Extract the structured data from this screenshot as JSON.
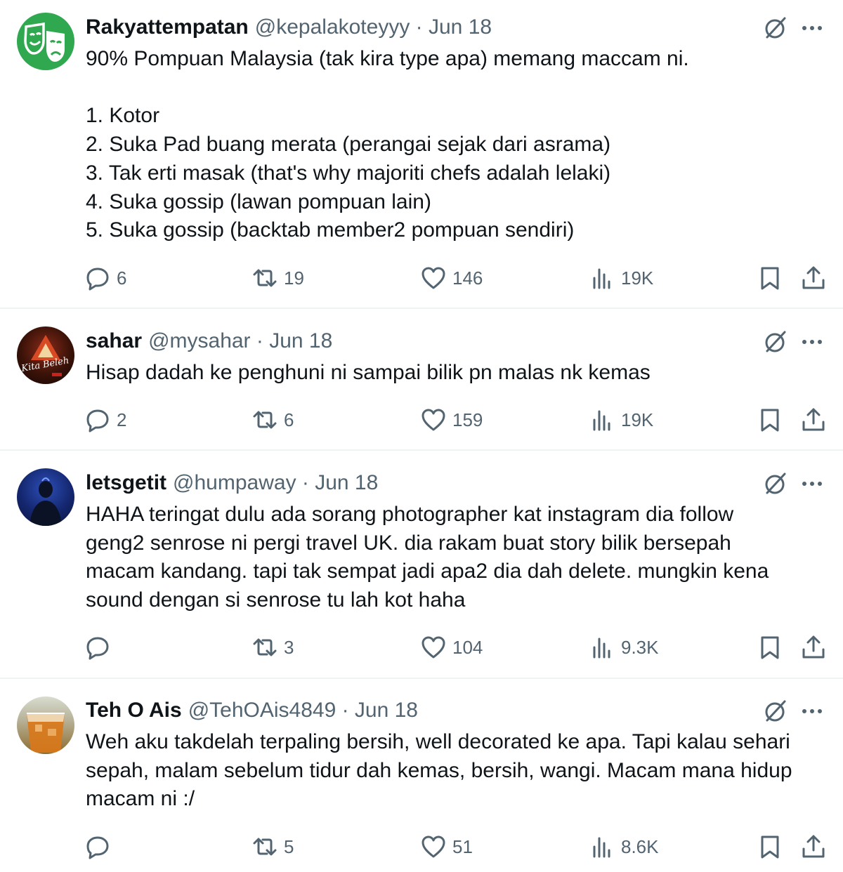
{
  "tweets": [
    {
      "name": "Rakyattempatan",
      "handle": "@kepalakoteyyy",
      "date": "Jun 18",
      "meta": "@kepalakoteyyy · Jun 18",
      "text": "90% Pompuan Malaysia (tak kira type apa) memang maccam ni.\n\n1.  Kotor\n2. Suka Pad buang merata (perangai sejak dari asrama)\n3. Tak erti masak (that's why majoriti chefs adalah lelaki)\n4. Suka gossip (lawan pompuan lain)\n5. Suka gossip (backtab member2 pompuan sendiri)",
      "replies": "6",
      "retweets": "19",
      "likes": "146",
      "views": "19K"
    },
    {
      "name": "sahar",
      "handle": "@mysahar",
      "date": "Jun 18",
      "meta": "@mysahar · Jun 18",
      "text": "Hisap dadah ke penghuni ni sampai bilik pn malas nk kemas",
      "replies": "2",
      "retweets": "6",
      "likes": "159",
      "views": "19K"
    },
    {
      "name": "letsgetit",
      "handle": "@humpaway",
      "date": "Jun 18",
      "meta": "@humpaway · Jun 18",
      "text": "HAHA teringat dulu ada sorang photographer kat instagram dia follow\ngeng2 senrose ni pergi travel UK. dia rakam buat story bilik bersepah\nmacam kandang. tapi tak sempat jadi apa2 dia dah delete. mungkin kena\nsound dengan si senrose tu lah kot haha",
      "replies": "",
      "retweets": "3",
      "likes": "104",
      "views": "9.3K"
    },
    {
      "name": "Teh O Ais",
      "handle": "@TehOAis4849",
      "date": "Jun 18",
      "meta": "@TehOAis4849 · Jun 18",
      "text": "Weh aku takdelah terpaling bersih, well decorated ke apa. Tapi kalau sehari\nsepah, malam sebelum tidur dah kemas, bersih, wangi. Macam mana hidup\nmacam ni :/",
      "replies": "",
      "retweets": "5",
      "likes": "51",
      "views": "8.6K"
    }
  ],
  "icons": {
    "reply": "reply-icon",
    "retweet": "retweet-icon",
    "like": "heart-icon",
    "views": "views-icon",
    "bookmark": "bookmark-icon",
    "share": "share-icon",
    "grok": "grok-icon",
    "more": "more-icon"
  },
  "colors": {
    "text": "#0f1419",
    "secondary": "#536471",
    "divider": "#eff3f4",
    "avatar1": "#2fa84f"
  }
}
